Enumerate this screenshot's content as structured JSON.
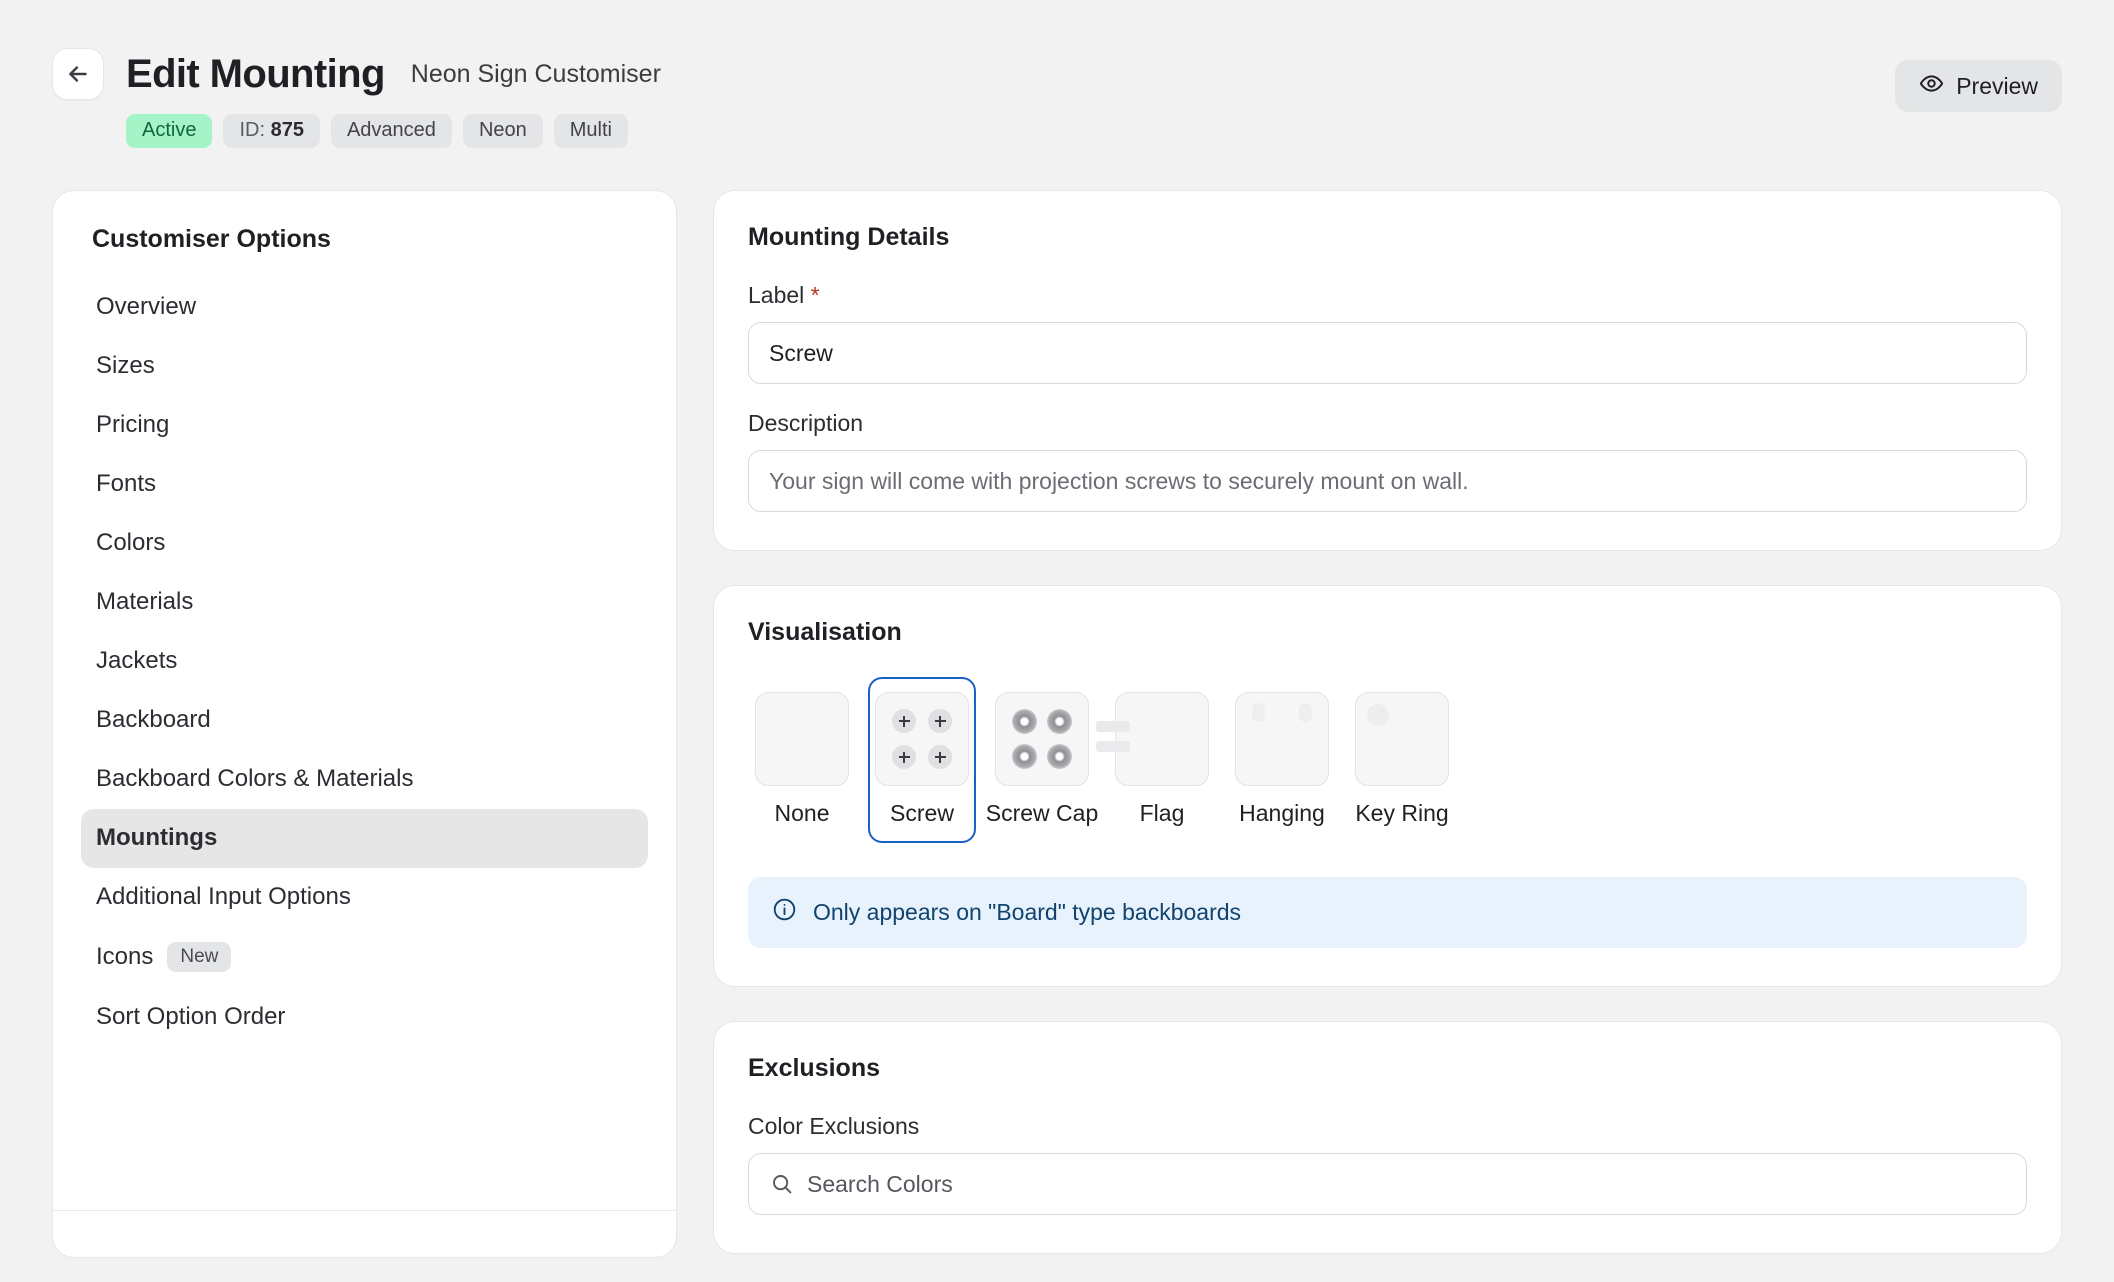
{
  "header": {
    "back_icon": "arrow-left-icon",
    "title": "Edit Mounting",
    "subtitle": "Neon Sign Customiser",
    "badges": [
      {
        "label": "Active",
        "style": "active"
      },
      {
        "label": "ID: ",
        "value": "875",
        "style": "id"
      },
      {
        "label": "Advanced",
        "style": "default"
      },
      {
        "label": "Neon",
        "style": "default"
      },
      {
        "label": "Multi",
        "style": "default"
      }
    ],
    "preview_label": "Preview",
    "preview_icon": "eye-icon",
    "accent_color": "#1a62c4",
    "active_badge_bg": "#a4f4c8",
    "active_badge_text": "#10663e"
  },
  "sidebar": {
    "title": "Customiser Options",
    "items": [
      {
        "label": "Overview",
        "selected": false
      },
      {
        "label": "Sizes",
        "selected": false
      },
      {
        "label": "Pricing",
        "selected": false
      },
      {
        "label": "Fonts",
        "selected": false
      },
      {
        "label": "Colors",
        "selected": false
      },
      {
        "label": "Materials",
        "selected": false
      },
      {
        "label": "Jackets",
        "selected": false
      },
      {
        "label": "Backboard",
        "selected": false
      },
      {
        "label": "Backboard Colors & Materials",
        "selected": false
      },
      {
        "label": "Mountings",
        "selected": true
      },
      {
        "label": "Additional Input Options",
        "selected": false
      },
      {
        "label": "Icons",
        "selected": false,
        "badge": "New"
      },
      {
        "label": "Sort Option Order",
        "selected": false
      }
    ]
  },
  "mounting_details": {
    "title": "Mounting Details",
    "label_field": {
      "label": "Label",
      "required_marker": "*",
      "value": "Screw",
      "placeholder": "Label"
    },
    "description_field": {
      "label": "Description",
      "value": "",
      "placeholder": "Your sign will come with projection screws to securely mount on wall."
    }
  },
  "visualisation": {
    "title": "Visualisation",
    "options": [
      {
        "label": "None",
        "icon": "blank-swatch-icon",
        "selected": false
      },
      {
        "label": "Screw",
        "icon": "screw-icon",
        "selected": true
      },
      {
        "label": "Screw Cap",
        "icon": "screw-cap-icon",
        "selected": false
      },
      {
        "label": "Flag",
        "icon": "flag-mount-icon",
        "selected": false
      },
      {
        "label": "Hanging",
        "icon": "hanging-icon",
        "selected": false
      },
      {
        "label": "Key Ring",
        "icon": "key-ring-icon",
        "selected": false
      }
    ],
    "info_icon": "info-circle-icon",
    "info_text": "Only appears on \"Board\" type backboards",
    "info_bg": "#e8f2fd",
    "info_text_color": "#10436e"
  },
  "exclusions": {
    "title": "Exclusions",
    "color_exclusions": {
      "label": "Color Exclusions",
      "search_icon": "search-icon",
      "placeholder": "Search Colors",
      "value": ""
    }
  }
}
